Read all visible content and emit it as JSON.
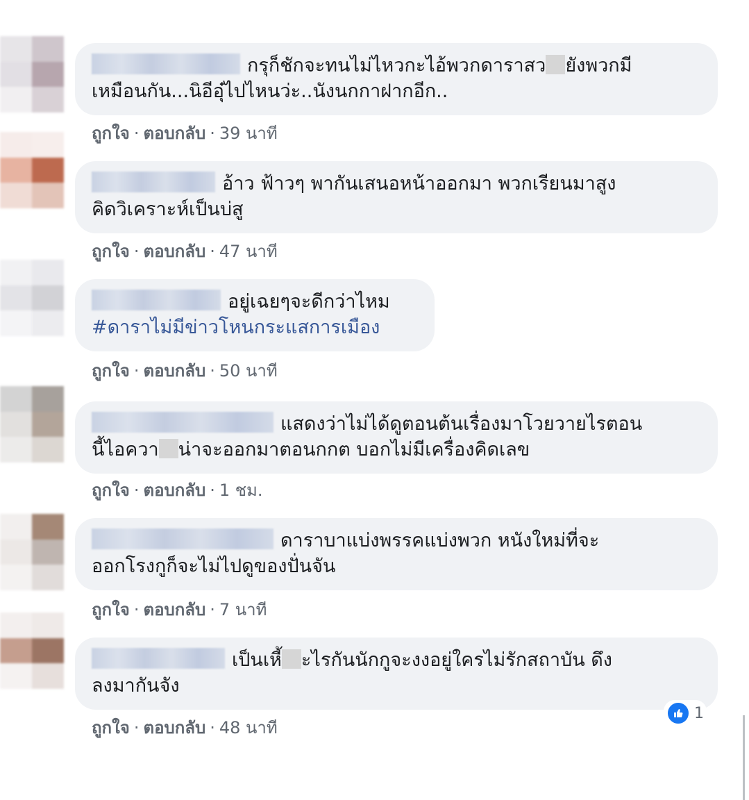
{
  "comments": [
    {
      "line1": "กรุก็ชักจะทนไม่ไหวกะไอ้พวกดาราสว",
      "line1b": "ยังพวกมี",
      "line2": "เหมือนกัน...นิอีอุ๋ไปไหนว่ะ..นังนกกาฝากอีก..",
      "like": "ถูกใจ",
      "reply": "ตอบกลับ",
      "time": "39 นาที"
    },
    {
      "line1": "อ้าว ฟ้าวๆ พากันเสนอหน้าออกมา พวกเรียนมาสูง",
      "line2": "คิดวิเคราะห์เป็นบ่สู",
      "like": "ถูกใจ",
      "reply": "ตอบกลับ",
      "time": "47 นาที"
    },
    {
      "line1": "อยู่เฉยๆจะดีกว่าไหม",
      "hashtag": "#ดาราไม่มีข่าวโหนกระแสการเมือง",
      "like": "ถูกใจ",
      "reply": "ตอบกลับ",
      "time": "50 นาที"
    },
    {
      "line1": "แสดงว่าไม่ได้ดูตอนต้นเรื่องมาโวยวายไรตอน",
      "line2a": "นี้ไอควา",
      "line2b": "น่าจะออกมาตอนกกต บอกไม่มีเครื่องคิดเลข",
      "like": "ถูกใจ",
      "reply": "ตอบกลับ",
      "time": "1 ชม."
    },
    {
      "line1": "ดาราบาแบ่งพรรคแบ่งพวก หนังใหม่ที่จะ",
      "line2": "ออกโรงกูก็จะไม่ไปดูของปั่นจัน",
      "like": "ถูกใจ",
      "reply": "ตอบกลับ",
      "time": "7 นาที"
    },
    {
      "line1a": "เป็นเหี้",
      "line1b": "ะไรกันนักกูจะงงอยู่ใครไม่รักสถาบัน ดึง",
      "line2": "ลงมากันจัง",
      "like": "ถูกใจ",
      "reply": "ตอบกลับ",
      "time": "48 นาที",
      "reaction_count": "1"
    }
  ],
  "separator": "·",
  "icons": {
    "like": "like-thumb-icon"
  },
  "colors": {
    "accent": "#1877f2",
    "bubble": "#f0f2f5",
    "hashtag": "#385898",
    "meta": "#606770"
  }
}
